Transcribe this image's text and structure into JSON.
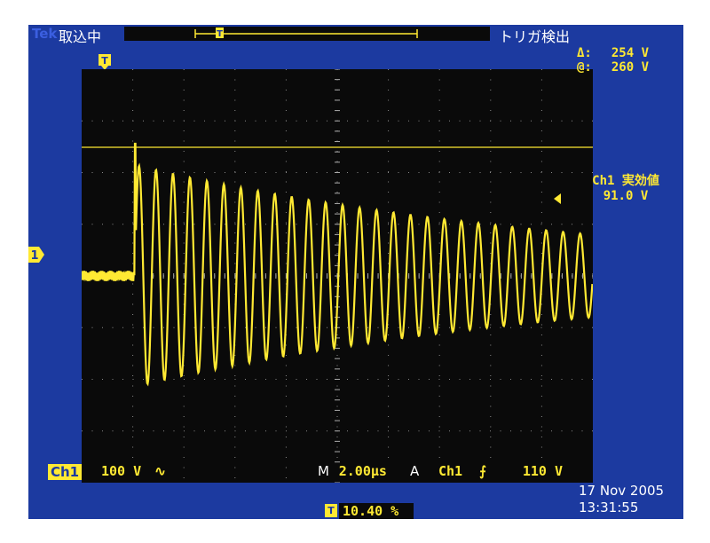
{
  "status": {
    "brand": "Tek",
    "acq_state": "取込中",
    "trigger_state": "トリガ検出"
  },
  "cursor_readout": {
    "delta_label": "Δ:",
    "delta_value": "254 V",
    "at_label": "@:",
    "at_value": "260 V"
  },
  "measurement": {
    "label": "Ch1 実効値",
    "value": "91.0 V"
  },
  "channel": {
    "name": "Ch1",
    "scale": "100 V",
    "coupling_symbol": "∿",
    "ref_marker": "1"
  },
  "timebase": {
    "mode": "M",
    "value": "2.00µs"
  },
  "trigger": {
    "label": "A",
    "source": "Ch1",
    "slope_symbol": "⨍",
    "level": "110 V",
    "marker": "T"
  },
  "horizontal_position": {
    "marker": "T",
    "value": "10.40 %"
  },
  "datetime": {
    "date": "17 Nov 2005",
    "time": "13:31:55"
  },
  "colors": {
    "frame": "#1c3aa0",
    "trace": "#ffe933",
    "screen": "#0a0a0a",
    "text": "#ffffff"
  },
  "chart_data": {
    "type": "line",
    "description": "Damped oscillation (ringing) waveform on Ch1 starting at trigger",
    "xlabel": "",
    "ylabel": "",
    "divisions": {
      "x": 10,
      "y": 8
    },
    "x_per_div_us": 2.0,
    "y_per_div_V": 100,
    "trigger_level_V": 110,
    "series": [
      {
        "pre_trigger_noise_V": 10,
        "trigger_time_us": 2.08,
        "initial_amplitude_V": 215,
        "final_amplitude_V": 80,
        "cycles_shown": 27,
        "duration_us": 20
      }
    ]
  }
}
